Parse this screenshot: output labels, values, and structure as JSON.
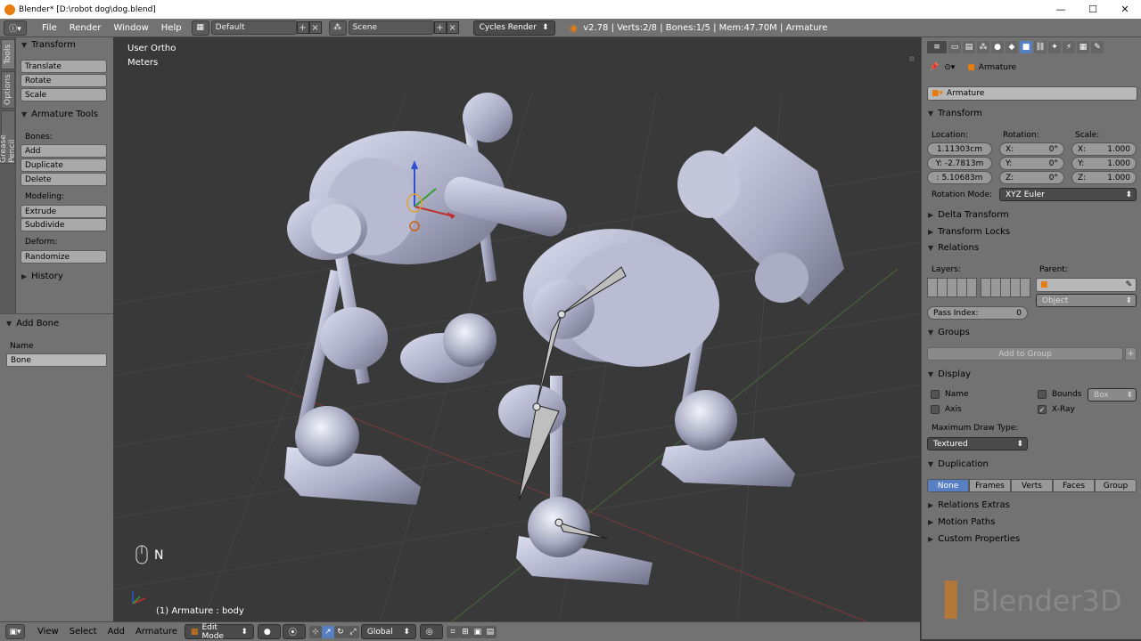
{
  "window": {
    "title": "Blender* [D:\\robot dog\\dog.blend]",
    "minimize": "—",
    "maximize": "☐",
    "close": "✕"
  },
  "topbar": {
    "menus": [
      "File",
      "Render",
      "Window",
      "Help"
    ],
    "screen_layout": "Default",
    "scene": "Scene",
    "render_engine": "Cycles Render",
    "stats": "v2.78 | Verts:2/8 | Bones:1/5 | Mem:47.70M | Armature"
  },
  "left_tabs": [
    "Tools",
    "Options",
    "Grease Pencil"
  ],
  "toolshelf": {
    "transform_header": "Transform",
    "transform_buttons": [
      "Translate",
      "Rotate",
      "Scale"
    ],
    "armature_tools_header": "Armature Tools",
    "bones_label": "Bones:",
    "bones_buttons": [
      "Add",
      "Duplicate",
      "Delete"
    ],
    "modeling_label": "Modeling:",
    "modeling_buttons": [
      "Extrude",
      "Subdivide"
    ],
    "deform_label": "Deform:",
    "deform_buttons": [
      "Randomize"
    ],
    "history_header": "History"
  },
  "operator": {
    "header": "Add Bone",
    "name_label": "Name",
    "name_value": "Bone"
  },
  "viewport": {
    "view_name": "User Ortho",
    "units": "Meters",
    "key_hint": "N",
    "object_info": "(1) Armature : body"
  },
  "properties": {
    "breadcrumb": "Armature",
    "object_name": "Armature",
    "transform_header": "Transform",
    "location_label": "Location:",
    "rotation_label": "Rotation:",
    "scale_label": "Scale:",
    "location": [
      "1.11303cm",
      "Y: -2.7813m",
      ": 5.10683m"
    ],
    "rotation": [
      {
        "k": "X:",
        "v": "0°"
      },
      {
        "k": "Y:",
        "v": "0°"
      },
      {
        "k": "Z:",
        "v": "0°"
      }
    ],
    "scale": [
      {
        "k": "X:",
        "v": "1.000"
      },
      {
        "k": "Y:",
        "v": "1.000"
      },
      {
        "k": "Z:",
        "v": "1.000"
      }
    ],
    "rotation_mode_label": "Rotation Mode:",
    "rotation_mode": "XYZ Euler",
    "delta_transform": "Delta Transform",
    "transform_locks": "Transform Locks",
    "relations_header": "Relations",
    "layers_label": "Layers:",
    "parent_label": "Parent:",
    "parent_type": "Object",
    "pass_index_label": "Pass Index:",
    "pass_index": "0",
    "groups_header": "Groups",
    "add_to_group": "Add to Group",
    "display_header": "Display",
    "display_name": "Name",
    "display_axis": "Axis",
    "display_bounds": "Bounds",
    "display_bounds_type": "Box",
    "display_xray": "X-Ray",
    "max_draw_type_label": "Maximum Draw Type:",
    "max_draw_type": "Textured",
    "duplication_header": "Duplication",
    "duplication_options": [
      "None",
      "Frames",
      "Verts",
      "Faces",
      "Group"
    ],
    "relations_extras": "Relations Extras",
    "motion_paths": "Motion Paths",
    "custom_properties": "Custom Properties",
    "watermark": "Blender3D"
  },
  "bottombar": {
    "menus": [
      "View",
      "Select",
      "Add",
      "Armature"
    ],
    "mode": "Edit Mode",
    "orientation": "Global"
  },
  "colors": {
    "panel": "#727272",
    "viewport": "#393939",
    "accent_blue": "#5680c2",
    "axis_red": "#a33",
    "axis_green": "#4a4",
    "axis_blue": "#33c"
  }
}
